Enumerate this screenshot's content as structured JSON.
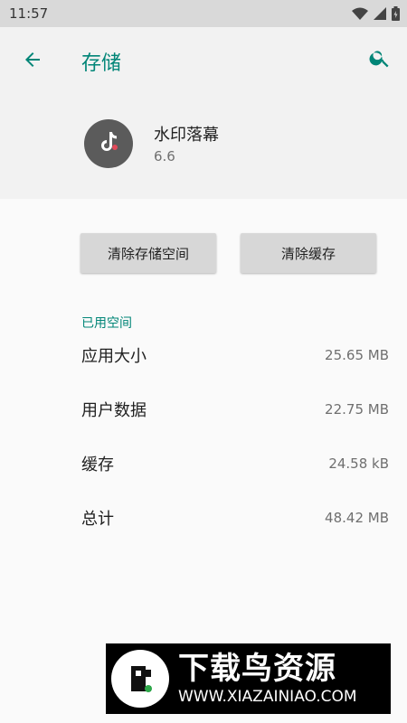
{
  "status_bar": {
    "time": "11:57",
    "icons": [
      "wifi-icon",
      "signal-icon",
      "battery-icon"
    ]
  },
  "toolbar": {
    "title": "存储",
    "back_icon": "arrow-left-icon",
    "search_icon": "search-icon"
  },
  "app": {
    "name": "水印落幕",
    "version": "6.6"
  },
  "buttons": {
    "clear_storage": "清除存储空间",
    "clear_cache": "清除缓存"
  },
  "section": {
    "title": "已用空间"
  },
  "rows": [
    {
      "label": "应用大小",
      "value": "25.65 MB"
    },
    {
      "label": "用户数据",
      "value": "22.75 MB"
    },
    {
      "label": "缓存",
      "value": "24.58 kB"
    },
    {
      "label": "总计",
      "value": "48.42 MB"
    }
  ],
  "watermark": {
    "title": "下载鸟资源",
    "url": "WWW.XIAZAINIAO.COM"
  },
  "colors": {
    "accent": "#008577",
    "status_bar": "#d9d9d9",
    "header_bg": "#f2f2f2",
    "button_bg": "#d7d7d7"
  }
}
